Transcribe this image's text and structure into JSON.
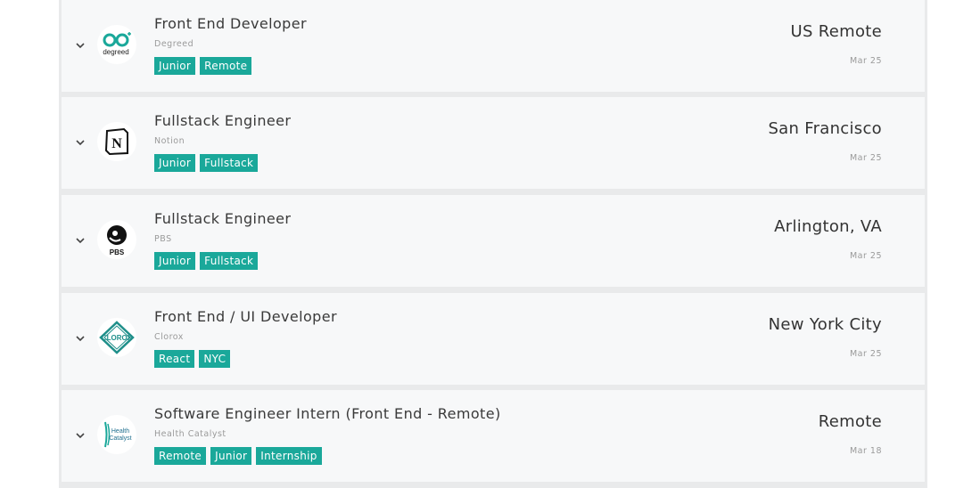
{
  "jobs": [
    {
      "title": "Front End Developer",
      "company": "Degreed",
      "logo_text": "degreed",
      "logo_icon": "glasses-logo",
      "tags": [
        "Junior",
        "Remote"
      ],
      "location": "US Remote",
      "date": "Mar 25"
    },
    {
      "title": "Fullstack Engineer",
      "company": "Notion",
      "logo_text": "N",
      "logo_icon": "notion-logo",
      "tags": [
        "Junior",
        "Fullstack"
      ],
      "location": "San Francisco",
      "date": "Mar 25"
    },
    {
      "title": "Fullstack Engineer",
      "company": "PBS",
      "logo_text": "PBS",
      "logo_icon": "pbs-logo",
      "tags": [
        "Junior",
        "Fullstack"
      ],
      "location": "Arlington, VA",
      "date": "Mar 25"
    },
    {
      "title": "Front End / UI Developer",
      "company": "Clorox",
      "logo_text": "CLOROX",
      "logo_icon": "clorox-logo",
      "tags": [
        "React",
        "NYC"
      ],
      "location": "New York City",
      "date": "Mar 25"
    },
    {
      "title": "Software Engineer Intern (Front End - Remote)",
      "company": "Health Catalyst",
      "logo_text": "Health Catalyst",
      "logo_icon": "health-catalyst-logo",
      "tags": [
        "Remote",
        "Junior",
        "Internship"
      ],
      "location": "Remote",
      "date": "Mar 18"
    }
  ],
  "colors": {
    "tag_bg": "#1aa89a",
    "card_bg": "#f7f8f9",
    "board_bg": "#e9eaeb",
    "degreed_teal": "#1aa89a",
    "clorox_teal": "#1f8f8a"
  },
  "icons": {
    "expand": "chevron-down-icon"
  }
}
